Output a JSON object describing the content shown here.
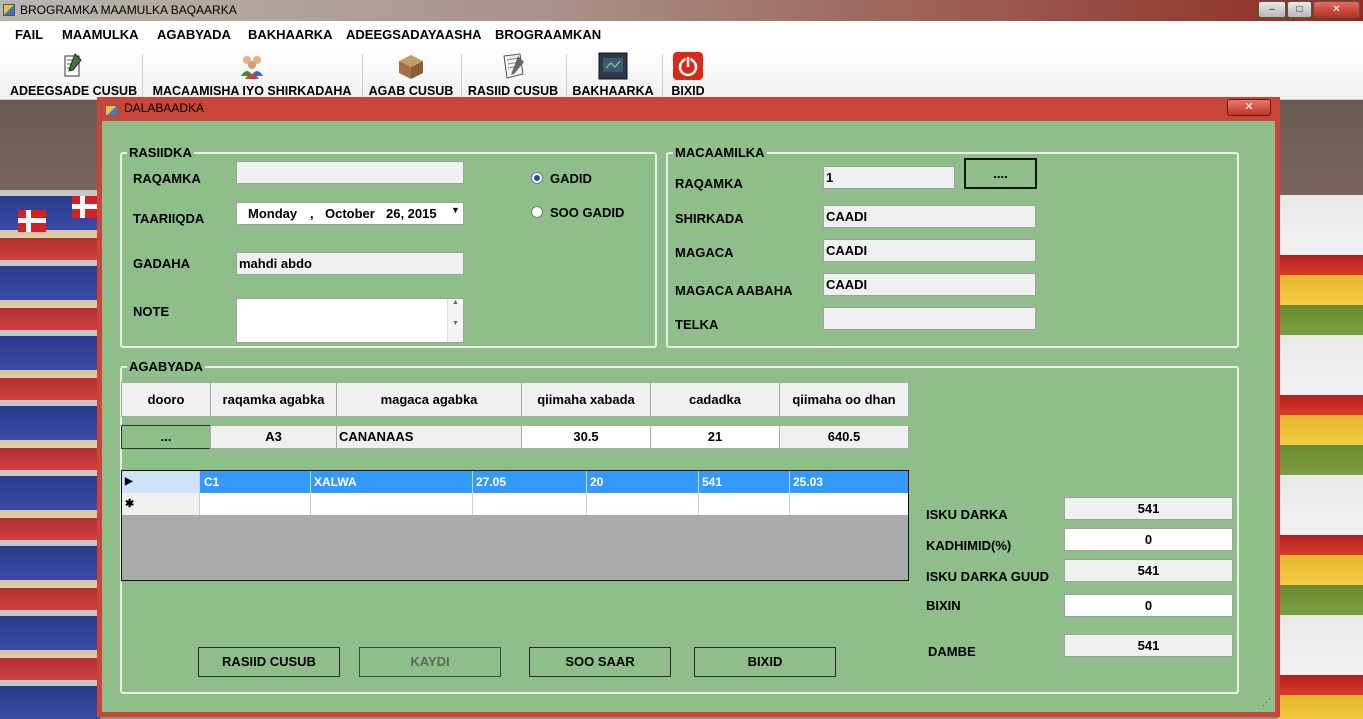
{
  "window": {
    "title": "BROGRAMKA  MAAMULKA BAQAARKA",
    "controls": {
      "minimize": "–",
      "maximize": "□",
      "close": "✕"
    }
  },
  "menu": [
    "FAIL",
    "MAAMULKA",
    "AGABYADA",
    "BAKHAARKA",
    "ADEEGSADAYAASHA",
    "BROGRAAMKAN"
  ],
  "toolbar": [
    {
      "label": "ADEEGSADE CUSUB",
      "icon": "user-add-icon"
    },
    {
      "label": "MACAAMISHA IYO SHIRKADAHA",
      "icon": "customers-icon"
    },
    {
      "label": "AGAB CUSUB",
      "icon": "box-icon"
    },
    {
      "label": "RASIID CUSUB",
      "icon": "receipt-icon"
    },
    {
      "label": "BAKHAARKA",
      "icon": "warehouse-icon"
    },
    {
      "label": "BIXID",
      "icon": "power-icon"
    }
  ],
  "dialog": {
    "title": "DALABAADKA",
    "close": "✕",
    "rasiidka": {
      "group_title": "RASIIDKA",
      "raqamka_label": "RAQAMKA",
      "raqamka_value": "",
      "taariiqda_label": "TAARIIQDA",
      "date_day": "Monday",
      "date_sep": ",",
      "date_month": "October",
      "date_rest": "26, 2015",
      "gadaha_label": "GADAHA",
      "gadaha_value": "mahdi abdo",
      "note_label": "NOTE",
      "note_value": "",
      "radio_gadid": "GADID",
      "radio_soo_gadid": "SOO GADID",
      "selected_radio": "GADID"
    },
    "macaamilka": {
      "group_title": "MACAAMILKA",
      "raqamka_label": "RAQAMKA",
      "raqamka_value": "1",
      "browse_button": "....",
      "shirkada_label": "SHIRKADA",
      "shirkada_value": "CAADI",
      "magaca_label": "MAGACA",
      "magaca_value": "CAADI",
      "magaca_aabaha_label": "MAGACA AABAHA",
      "magaca_aabaha_value": "CAADI",
      "telka_label": "TELKA",
      "telka_value": ""
    },
    "agabyada": {
      "group_title": "AGABYADA",
      "headers": [
        "dooro",
        "raqamka agabka",
        "magaca agabka",
        "qiimaha xabada",
        "cadadka",
        "qiimaha oo dhan"
      ],
      "entry": {
        "dooro": "...",
        "raqamka": "A3",
        "magaca": "CANANAAS",
        "qiimaha_xabada": "30.5",
        "cadadka": "21",
        "qiimaha_oo_dhan": "640.5"
      },
      "grid_rows": [
        {
          "indicator": "▶",
          "cells": [
            "C1",
            "XALWA",
            "27.05",
            "20",
            "541",
            "25.03"
          ]
        },
        {
          "indicator": "✱",
          "cells": [
            "",
            "",
            "",
            "",
            "",
            ""
          ]
        }
      ]
    },
    "totals": {
      "isku_darka_label": "ISKU DARKA",
      "isku_darka_value": "541",
      "kadhimid_label": "KADHIMID(%)",
      "kadhimid_value": "0",
      "isku_darka_guud_label": "ISKU DARKA GUUD",
      "isku_darka_guud_value": "541",
      "bixin_label": "BIXIN",
      "bixin_value": "0",
      "dambe_label": "DAMBE",
      "dambe_value": "541"
    },
    "buttons": {
      "rasiid_cusub": "RASIID CUSUB",
      "kaydi": "KAYDI",
      "soo_saar": "SOO SAAR",
      "bixid": "BIXID"
    }
  },
  "colors": {
    "dialog_bg": "#8fbe8b",
    "dialog_frame": "#c9453a",
    "selection": "#3399ff"
  }
}
